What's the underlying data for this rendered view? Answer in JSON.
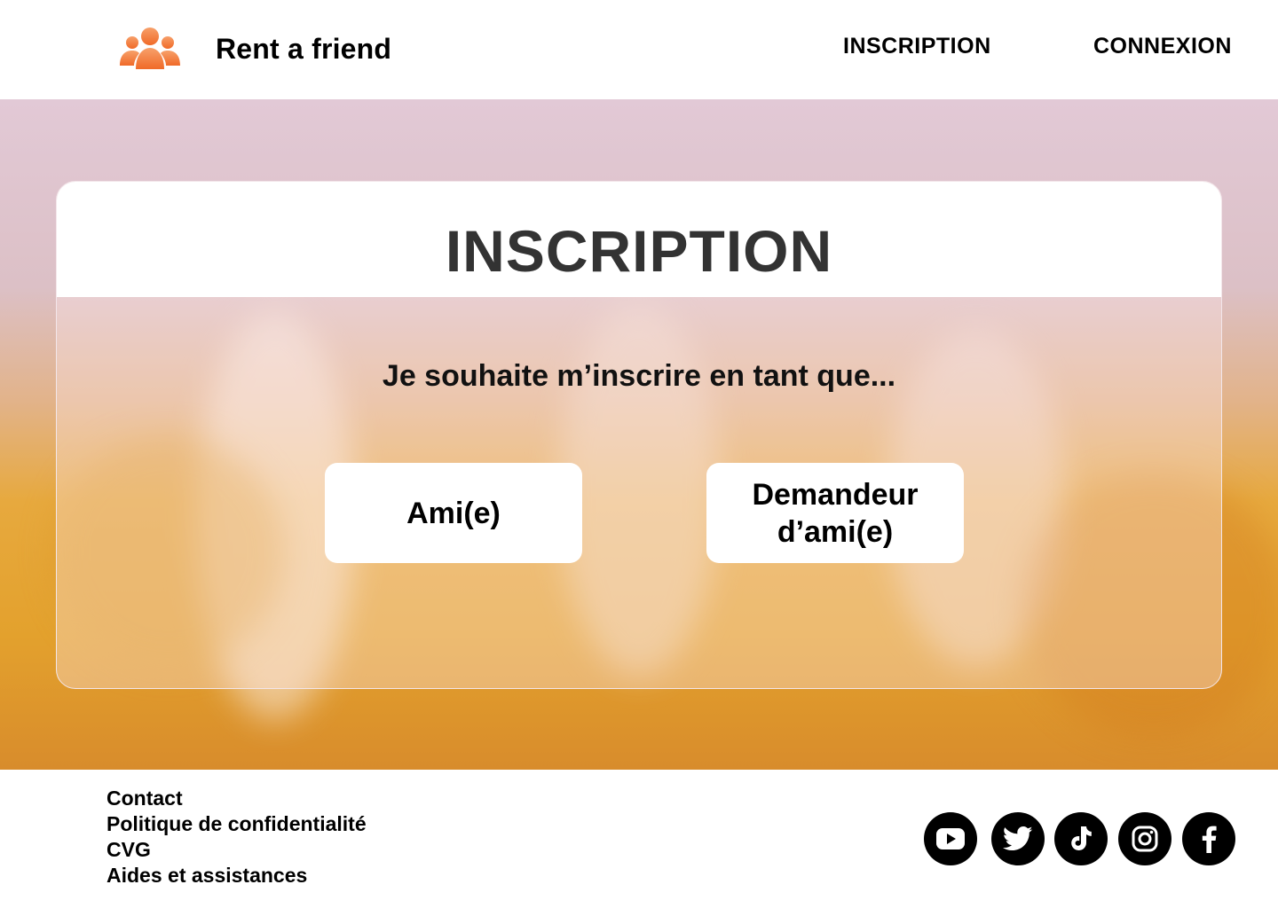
{
  "header": {
    "brand": "Rent a friend",
    "nav": {
      "inscription": "INSCRIPTION",
      "connexion": "CONNEXION"
    }
  },
  "card": {
    "title": "INSCRIPTION",
    "prompt": "Je souhaite m’inscrire en tant que...",
    "options": [
      {
        "label": "Ami(e)"
      },
      {
        "label_line1": "Demandeur",
        "label_line2": "d’ami(e)"
      }
    ]
  },
  "footer": {
    "links": [
      "Contact",
      "Politique de confidentialité",
      "CVG",
      "Aides et assistances"
    ],
    "social": [
      "youtube-icon",
      "twitter-icon",
      "tiktok-icon",
      "instagram-icon",
      "facebook-icon"
    ]
  },
  "colors": {
    "accent": "#f47d3c",
    "title": "#333333"
  }
}
